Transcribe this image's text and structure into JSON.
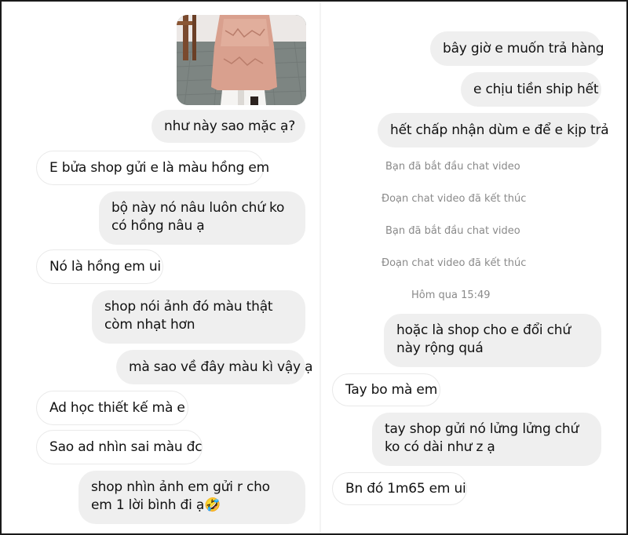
{
  "left_column": {
    "messages": [
      {
        "text": "như này sao mặc ạ?",
        "sender": "me"
      },
      {
        "text": "E bửa shop gửi e là màu hồng em",
        "sender": "shop"
      },
      {
        "text": "bộ này nó nâu luôn chứ ko có hồng nâu ạ",
        "sender": "me"
      },
      {
        "text": "Nó là hồng em ui",
        "sender": "shop"
      },
      {
        "text": "shop nói ảnh đó màu thật còm nhạt hơn",
        "sender": "me"
      },
      {
        "text": "mà sao về đây màu kì vậy ạ",
        "sender": "me"
      },
      {
        "text": "Ad học thiết kế mà e",
        "sender": "shop"
      },
      {
        "text": "Sao ad nhìn sai màu đc",
        "sender": "shop"
      },
      {
        "text": "shop nhìn ảnh em gửi r cho em 1 lời bình đi ạ🤣",
        "sender": "me"
      }
    ]
  },
  "right_column": {
    "messages": [
      {
        "text": "bây giờ e muốn trả hàng",
        "sender": "me"
      },
      {
        "text": "e chịu tiền ship hết",
        "sender": "me"
      },
      {
        "text": "hết chấp nhận dùm e để e kịp trả",
        "sender": "me"
      },
      {
        "text": "hoặc là shop cho e đổi chứ này rộng quá",
        "sender": "me"
      },
      {
        "text": "Tay bo mà em",
        "sender": "shop"
      },
      {
        "text": "tay shop gửi nó lửng lửng chứ ko có dài như z ạ",
        "sender": "me"
      },
      {
        "text": "Bn đó 1m65 em ui",
        "sender": "shop"
      }
    ],
    "system_events": [
      "Bạn đã bắt đầu chat video",
      "Đoạn chat video đã kết thúc",
      "Bạn đã bắt đầu chat video",
      "Đoạn chat video đã kết thúc"
    ],
    "timestamp": "Hôm qua 15:49"
  },
  "colors": {
    "outgoing_bubble": "#efefef",
    "incoming_bubble": "#ffffff",
    "system_text": "#8a8a8a",
    "photo_top_wall": "#ece8e6",
    "dress": "#d9a08e"
  },
  "photo": {
    "subject": "pink-brown-dress-photo"
  }
}
